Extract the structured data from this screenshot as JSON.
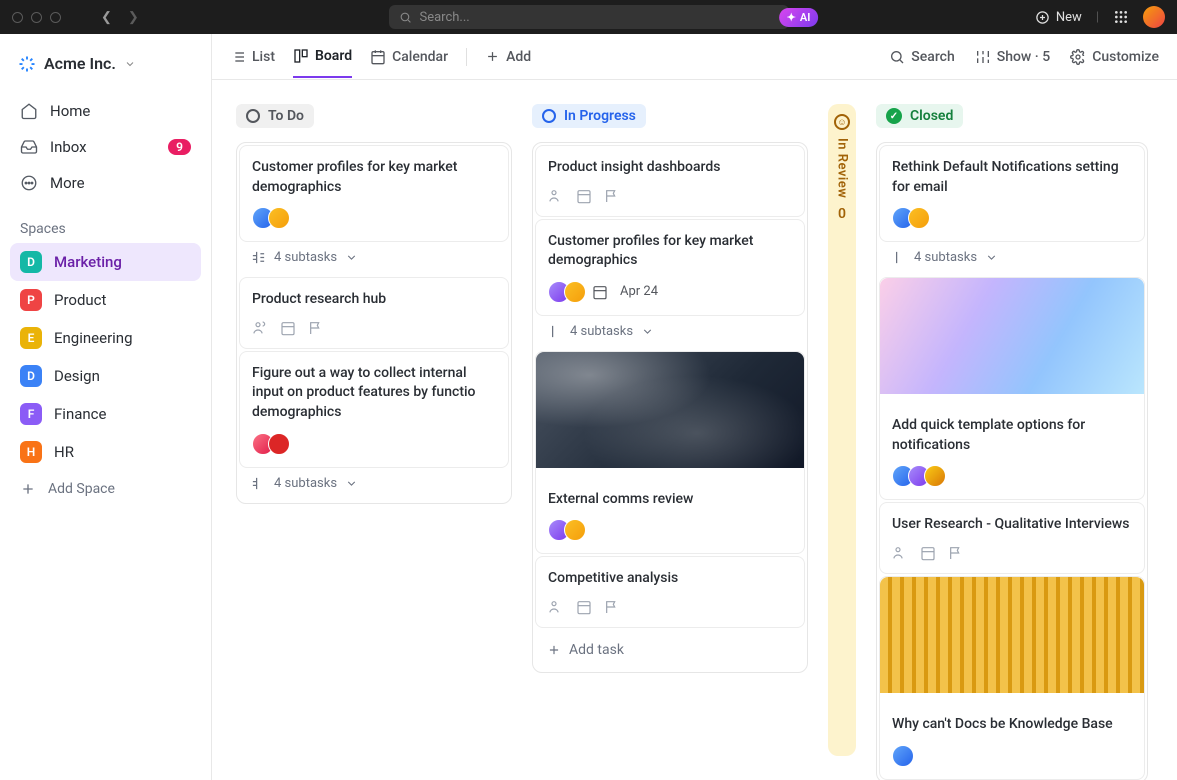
{
  "titlebar": {
    "search_placeholder": "Search...",
    "ai_label": "AI",
    "new_label": "New"
  },
  "workspace": {
    "name": "Acme Inc."
  },
  "nav": {
    "home": "Home",
    "inbox": "Inbox",
    "inbox_count": "9",
    "more": "More"
  },
  "spaces_label": "Spaces",
  "spaces": [
    {
      "letter": "D",
      "name": "Marketing",
      "color": "#14b8a6",
      "active": true
    },
    {
      "letter": "P",
      "name": "Product",
      "color": "#ef4444"
    },
    {
      "letter": "E",
      "name": "Engineering",
      "color": "#eab308"
    },
    {
      "letter": "D",
      "name": "Design",
      "color": "#3b82f6"
    },
    {
      "letter": "F",
      "name": "Finance",
      "color": "#8b5cf6"
    },
    {
      "letter": "H",
      "name": "HR",
      "color": "#f97316"
    }
  ],
  "add_space_label": "Add Space",
  "views": {
    "list": "List",
    "board": "Board",
    "calendar": "Calendar",
    "add": "Add",
    "search": "Search",
    "show": "Show · 5",
    "customize": "Customize"
  },
  "columns": {
    "todo": {
      "label": "To Do"
    },
    "progress": {
      "label": "In Progress"
    },
    "review": {
      "label": "In Review",
      "count": "0"
    },
    "closed": {
      "label": "Closed"
    }
  },
  "cards": {
    "todo1": {
      "title": "Customer profiles for key market demographics",
      "subtasks": "4 subtasks"
    },
    "todo2": {
      "title": "Product research hub"
    },
    "todo3": {
      "title": "Figure out a way to collect internal input on product features by functio demographics",
      "subtasks": "4 subtasks"
    },
    "prog1": {
      "title": "Product insight dashboards"
    },
    "prog2": {
      "title": "Customer profiles for key market demographics",
      "date": "Apr 24",
      "subtasks": "4 subtasks"
    },
    "prog3": {
      "title": "External comms review"
    },
    "prog4": {
      "title": "Competitive analysis"
    },
    "closed1": {
      "title": "Rethink Default Notifications setting for email",
      "subtasks": "4 subtasks"
    },
    "closed2": {
      "title": "Add quick template options for notifications"
    },
    "closed3": {
      "title": "User Research - Qualitative Interviews"
    },
    "closed4": {
      "title": "Why can't Docs be Knowledge Base"
    }
  },
  "add_task_label": "Add task"
}
